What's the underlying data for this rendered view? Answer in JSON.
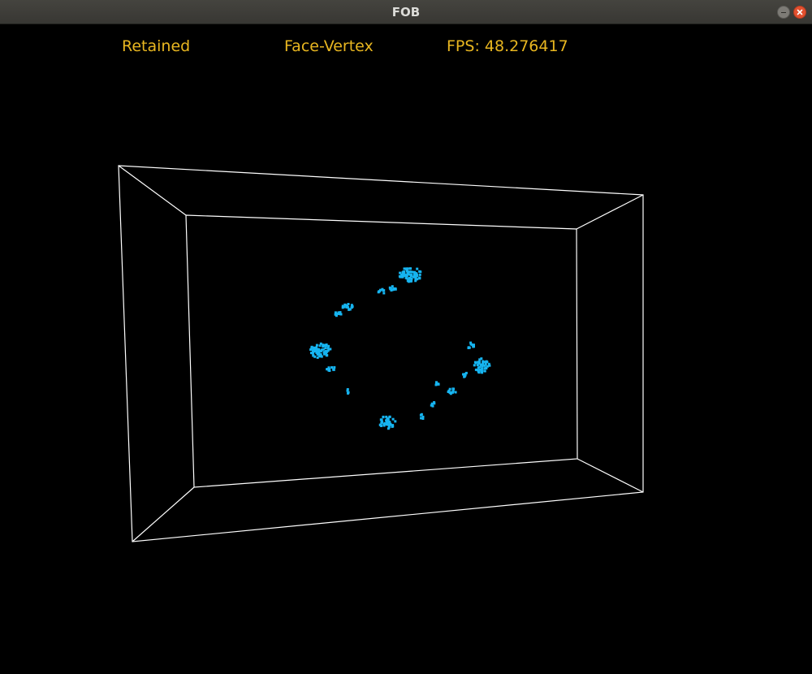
{
  "window": {
    "title": "FOB",
    "minimize_icon": "minimize-icon",
    "close_icon": "close-icon"
  },
  "hud": {
    "render_mode": "Retained",
    "mesh_format": "Face-Vertex",
    "fps_label": "FPS:",
    "fps_value": "48.276417"
  },
  "colors": {
    "hud_text": "#e8b620",
    "wireframe": "#ffffff",
    "points": "#16b4f0",
    "background": "#000000"
  }
}
